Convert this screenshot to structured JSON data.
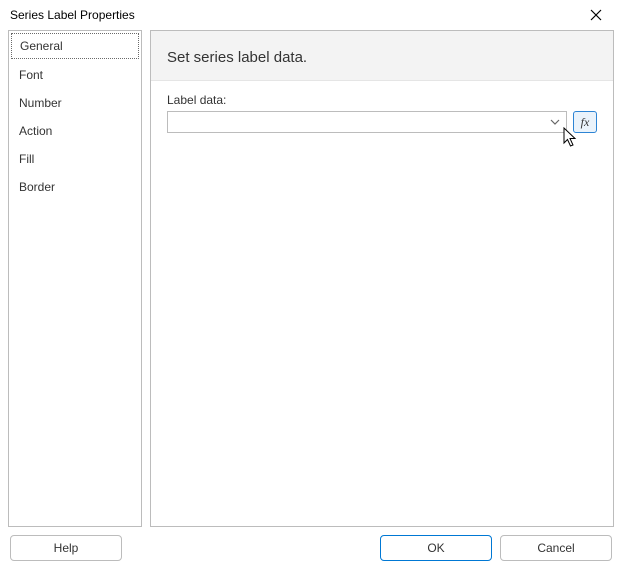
{
  "titlebar": {
    "title": "Series Label Properties"
  },
  "sidebar": {
    "items": [
      {
        "label": "General",
        "selected": true
      },
      {
        "label": "Font"
      },
      {
        "label": "Number"
      },
      {
        "label": "Action"
      },
      {
        "label": "Fill"
      },
      {
        "label": "Border"
      }
    ]
  },
  "panel": {
    "header": "Set series label data.",
    "label_data_label": "Label data:",
    "label_data_value": "",
    "fx_label": "fx"
  },
  "buttons": {
    "help": "Help",
    "ok": "OK",
    "cancel": "Cancel"
  }
}
